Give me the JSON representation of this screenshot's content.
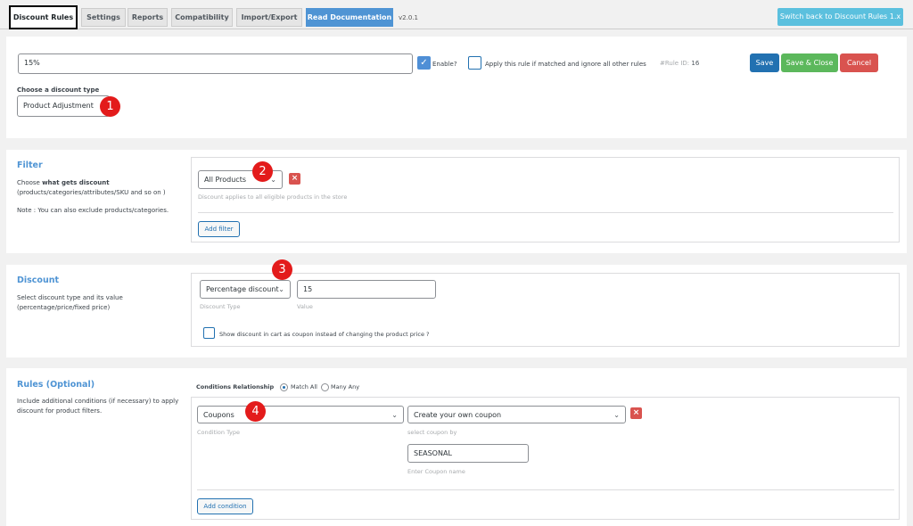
{
  "tabs": [
    {
      "label": "Discount Rules"
    },
    {
      "label": "Settings"
    },
    {
      "label": "Reports"
    },
    {
      "label": "Compatibility"
    },
    {
      "label": "Import/Export"
    },
    {
      "label": "Read Documentation"
    }
  ],
  "version": "v2.0.1",
  "switch_button": "Switch back to Discount Rules 1.x",
  "header": {
    "rule_title_value": "15%",
    "enable_label": "Enable?",
    "apply_exclusive_label": "Apply this rule if matched and ignore all other rules",
    "rule_id_label": "#Rule ID:",
    "rule_id_value": "16",
    "save_label": "Save",
    "save_close_label": "Save & Close",
    "cancel_label": "Cancel",
    "discount_type_label": "Choose a discount type",
    "discount_type_value": "Product Adjustment"
  },
  "filter": {
    "title": "Filter",
    "desc_prefix": "Choose ",
    "desc_bold": "what gets discount",
    "desc_line2": "(products/categories/attributes/SKU and so on )",
    "note": "Note : You can also exclude products/categories.",
    "select_value": "All Products",
    "help": "Discount applies to all eligible products in the store",
    "add_filter_label": "Add filter"
  },
  "discount": {
    "title": "Discount",
    "desc_line1": "Select discount type and its value",
    "desc_line2": "(percentage/price/fixed price)",
    "type_value": "Percentage discount",
    "type_caption": "Discount Type",
    "value": "15",
    "value_caption": "Value",
    "coupon_label": "Show discount in cart as coupon instead of changing the product price ?"
  },
  "rules": {
    "title": "Rules (Optional)",
    "desc_line1": "Include additional conditions (if necessary) to apply",
    "desc_line2": "discount for product filters.",
    "relationship_label": "Conditions Relationship",
    "match_all": "Match All",
    "many_any": "Many Any",
    "condition_type_value": "Coupons",
    "condition_type_caption": "Condition Type",
    "coupon_mode_value": "Create your own coupon",
    "coupon_mode_caption": "select coupon by",
    "coupon_name_value": "SEASONAL",
    "coupon_name_caption": "Enter Coupon name",
    "add_condition_label": "Add condition"
  },
  "badges": [
    "1",
    "2",
    "3",
    "4"
  ],
  "colors": {
    "accent": "#4f94d4",
    "save": "#2271b1",
    "save_close": "#5cb85c",
    "cancel": "#d9534f",
    "badge": "#e31b1b"
  }
}
